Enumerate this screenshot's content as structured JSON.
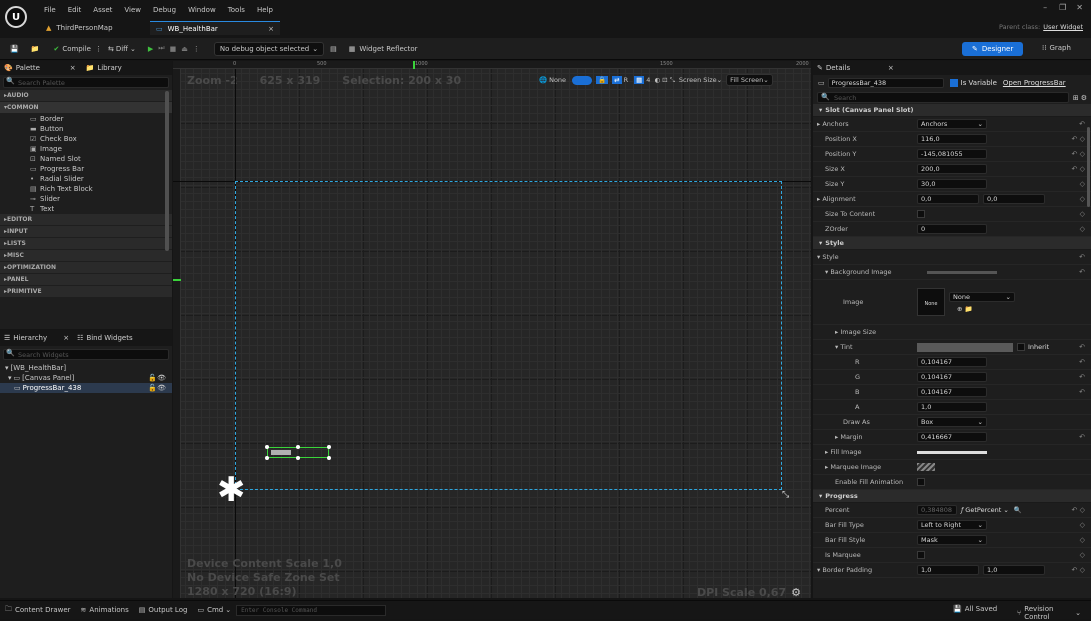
{
  "menu": [
    "File",
    "Edit",
    "Asset",
    "View",
    "Debug",
    "Window",
    "Tools",
    "Help"
  ],
  "tabs": {
    "map": "ThirdPersonMap",
    "widget": "WB_HealthBar"
  },
  "parent_class_label": "Parent class:",
  "parent_class_value": "User Widget",
  "toolbar": {
    "compile": "Compile",
    "diff": "Diff",
    "debug_object": "No debug object selected",
    "widget_reflector": "Widget Reflector",
    "designer": "Designer",
    "graph": "Graph"
  },
  "palette": {
    "tab": "Palette",
    "library_tab": "Library",
    "search_placeholder": "Search Palette",
    "categories_top": [
      "AUDIO"
    ],
    "common": "COMMON",
    "items": [
      {
        "icon": "▭",
        "label": "Border"
      },
      {
        "icon": "▬",
        "label": "Button"
      },
      {
        "icon": "☑",
        "label": "Check Box"
      },
      {
        "icon": "▣",
        "label": "Image"
      },
      {
        "icon": "⊡",
        "label": "Named Slot"
      },
      {
        "icon": "▭",
        "label": "Progress Bar"
      },
      {
        "icon": "•",
        "label": "Radial Slider"
      },
      {
        "icon": "▤",
        "label": "Rich Text Block"
      },
      {
        "icon": "⊸",
        "label": "Slider"
      },
      {
        "icon": "T",
        "label": "Text"
      }
    ],
    "categories_bottom": [
      "EDITOR",
      "INPUT",
      "LISTS",
      "MISC",
      "OPTIMIZATION",
      "PANEL",
      "PRIMITIVE"
    ]
  },
  "hierarchy": {
    "tab": "Hierarchy",
    "bind_tab": "Bind Widgets",
    "search_placeholder": "Search Widgets",
    "root": "[WB_HealthBar]",
    "canvas": "[Canvas Panel]",
    "progress": "ProgressBar_438"
  },
  "canvas": {
    "zoom": "Zoom -2",
    "resolution": "625 x 319",
    "selection": "Selection: 200 x 30",
    "ruler": [
      "0",
      "500",
      "1000",
      "1500",
      "2000"
    ],
    "none_btn": "None",
    "r_btn": "R",
    "grid_num": "4",
    "screen_size": "Screen Size",
    "fill_screen": "Fill Screen",
    "device_scale": "Device Content Scale 1,0",
    "safe_zone": "No Device Safe Zone Set",
    "res_line": "1280 x 720 (16:9)",
    "dpi": "DPI Scale 0,67"
  },
  "details": {
    "tab": "Details",
    "name": "ProgressBar_438",
    "is_variable": "Is Variable",
    "open_link": "Open ProgressBar",
    "search_placeholder": "Search",
    "slot_section": "Slot (Canvas Panel Slot)",
    "anchors_label": "Anchors",
    "anchors_val": "Anchors",
    "pos_x_label": "Position X",
    "pos_x": "116,0",
    "pos_y_label": "Position Y",
    "pos_y": "-145,081055",
    "size_x_label": "Size X",
    "size_x": "200,0",
    "size_y_label": "Size Y",
    "size_y": "30,0",
    "align_label": "Alignment",
    "align_x": "0,0",
    "align_y": "0,0",
    "size_content_label": "Size To Content",
    "zorder_label": "ZOrder",
    "zorder": "0",
    "style_section": "Style",
    "style_sub": "Style",
    "bg_image": "Background Image",
    "image_label": "Image",
    "image_none": "None",
    "image_dd": "None",
    "image_size": "Image Size",
    "tint": "Tint",
    "inherit": "Inherit",
    "r_label": "R",
    "r": "0,104167",
    "g_label": "G",
    "g": "0,104167",
    "b_label": "B",
    "b": "0,104167",
    "a_label": "A",
    "a": "1,0",
    "draw_as_label": "Draw As",
    "draw_as": "Box",
    "margin_label": "Margin",
    "margin": "0,416667",
    "fill_image": "Fill Image",
    "marquee_image": "Marquee Image",
    "fill_anim": "Enable Fill Animation",
    "progress_section": "Progress",
    "percent_label": "Percent",
    "percent": "0,384808",
    "get_percent": "GetPercent",
    "bar_fill_type_label": "Bar Fill Type",
    "bar_fill_type": "Left to Right",
    "bar_fill_style_label": "Bar Fill Style",
    "bar_fill_style": "Mask",
    "is_marquee_label": "Is Marquee",
    "border_padding_label": "Border Padding",
    "bp_x": "1,0",
    "bp_y": "1,0"
  },
  "status": {
    "content_drawer": "Content Drawer",
    "animations": "Animations",
    "output_log": "Output Log",
    "cmd": "Cmd",
    "console_placeholder": "Enter Console Command",
    "saved": "All Saved",
    "revision": "Revision Control"
  },
  "colors": {
    "accent": "#1a6fd6",
    "selection_outline": "#2fa8e0",
    "widget_outline": "#3ad43a"
  }
}
